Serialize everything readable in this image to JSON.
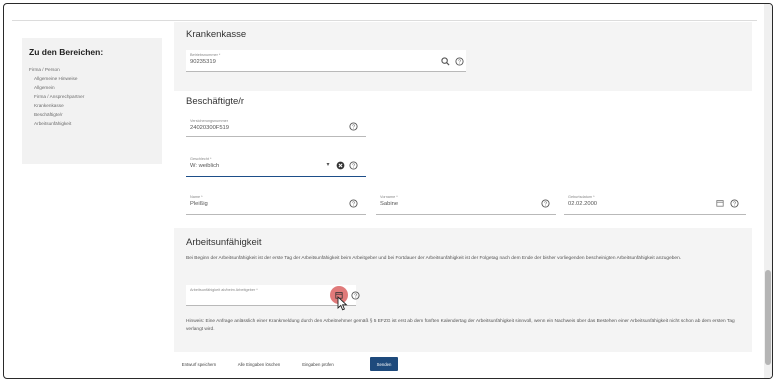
{
  "sidebar": {
    "heading": "Zu den Bereichen:",
    "items": [
      {
        "label": "Firma / Person",
        "sub": false
      },
      {
        "label": "Allgemeine Hinweise",
        "sub": true
      },
      {
        "label": "Allgemein",
        "sub": true
      },
      {
        "label": "Firma / Ansprechpartner",
        "sub": true
      },
      {
        "label": "Krankenkasse",
        "sub": true
      },
      {
        "label": "Beschäftigte/r",
        "sub": true
      },
      {
        "label": "Arbeitsunfähigkeit",
        "sub": true
      }
    ]
  },
  "krankenkasse": {
    "title": "Krankenkasse",
    "betriebsnummer_label": "Betriebsnummer *",
    "betriebsnummer_value": "90235319",
    "search_icon": "search-icon",
    "help_icon": "help-icon"
  },
  "beschaeftigte": {
    "title": "Beschäftigte/r",
    "versicherungsnummer_label": "Versicherungsnummer",
    "versicherungsnummer_value": "24020300F519",
    "geschlecht_label": "Geschlecht *",
    "geschlecht_value": "W: weiblich",
    "name_label": "Name *",
    "name_value": "Pleißig",
    "vorname_label": "Vorname *",
    "vorname_value": "Sabine",
    "geburtsdatum_label": "Geburtsdatum *",
    "geburtsdatum_value": "02.02.2000"
  },
  "arbeitsunfaehigkeit": {
    "title": "Arbeitsunfähigkeit",
    "intro": "Bei Beginn der Arbeitsunfähigkeit ist der erste Tag der Arbeitsunfähigkeit beim Arbeitgeber und bei Fortdauer der Arbeitsunfähigkeit ist der Folgetag nach dem Ende der bisher vorliegenden bescheinigten Arbeitsunfähigkeit anzugeben.",
    "date_label": "Arbeitsunfähigkeit ab/beim Arbeitgeber *",
    "date_value": "",
    "hint": "Hinweis: Eine Anfrage anlässlich einer Krankmeldung durch den Arbeitnehmer gemäß § 5 EFZG ist erst ab dem fünften Kalendertag der Arbeitsunfähigkeit sinnvoll, wenn ein Nachweis über das Bestehen einer Arbeitsunfähigkeit nicht schon ab dem ersten Tag verlangt wird."
  },
  "actions": {
    "save_draft": "Entwurf speichern",
    "clear_all": "Alle Eingaben löschen",
    "check": "Eingaben prüfen",
    "send": "Senden"
  },
  "colors": {
    "primary": "#1e4a7c",
    "highlight": "#e07a7a",
    "panel": "#f4f4f4"
  }
}
